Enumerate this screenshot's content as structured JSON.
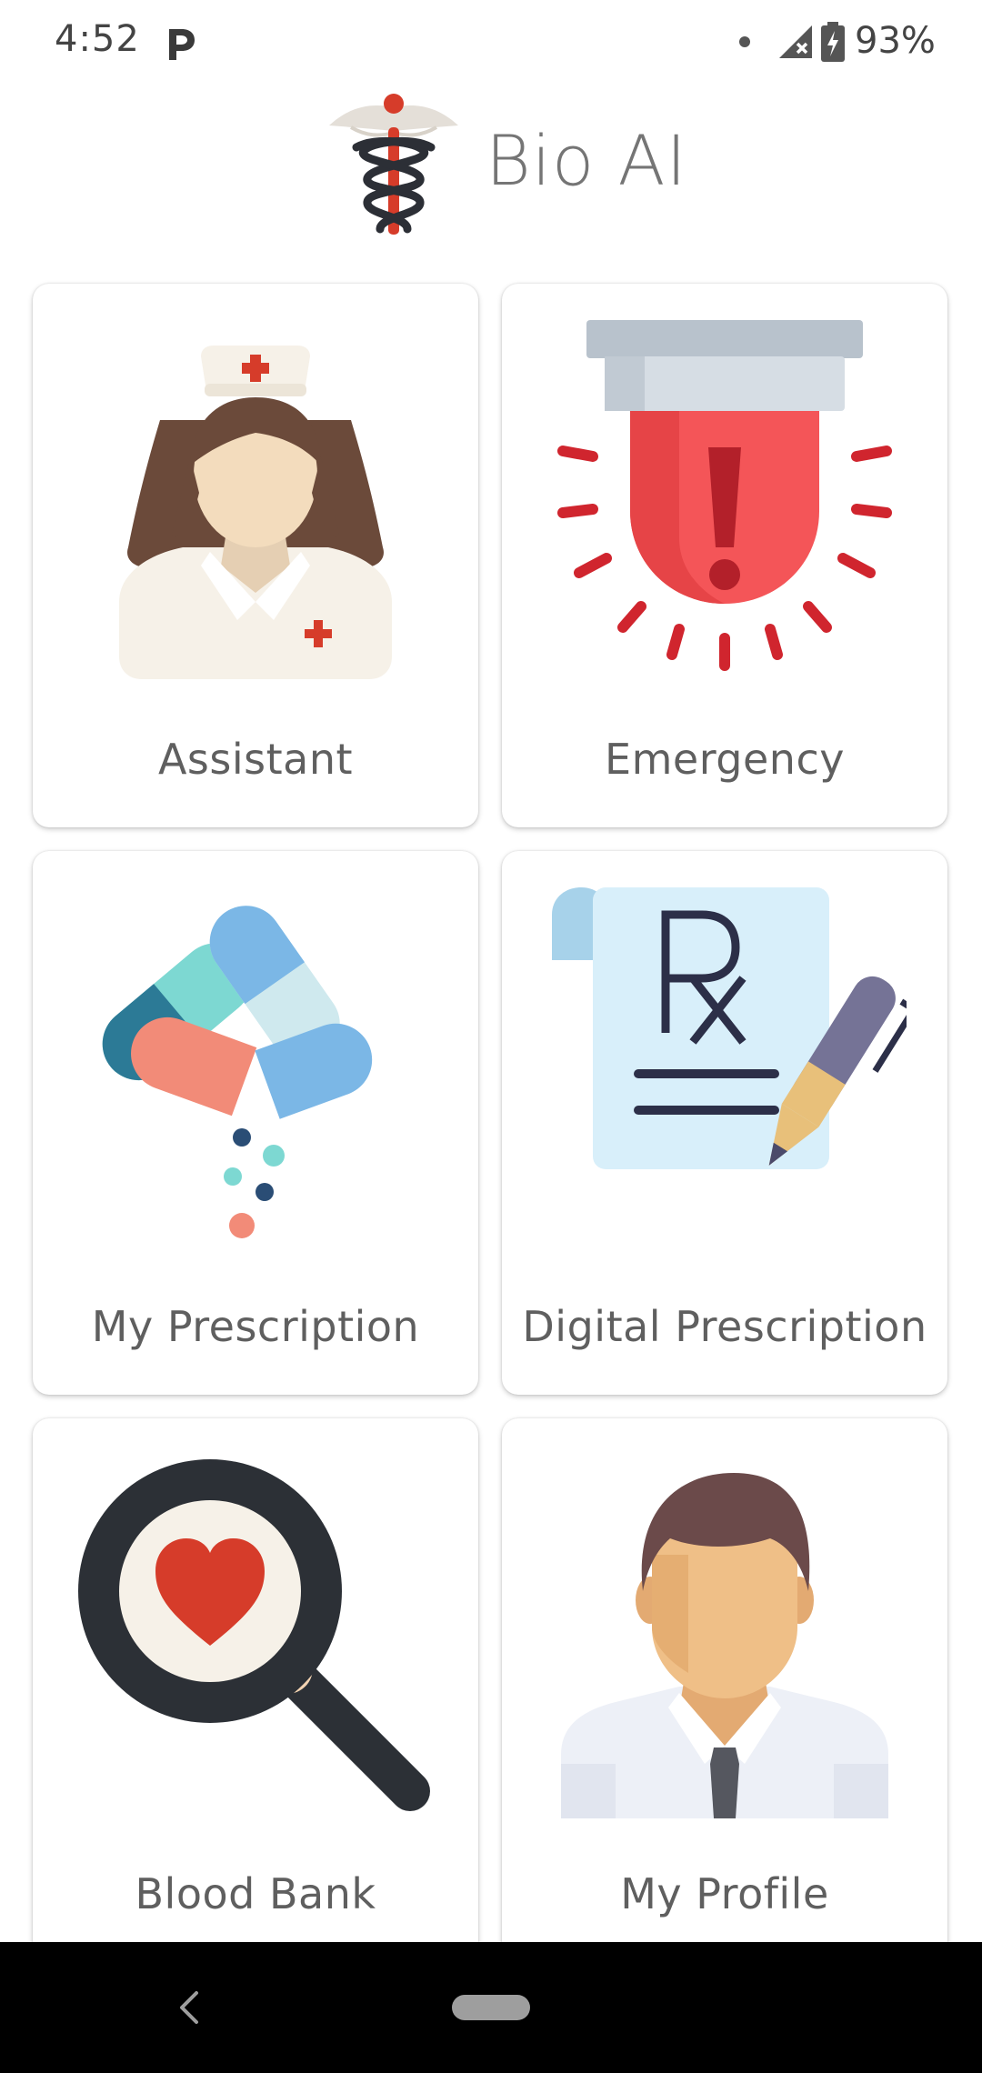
{
  "status_bar": {
    "time": "4:52",
    "battery": "93%",
    "icons": [
      "parking-icon",
      "notification-dot-icon",
      "no-signal-icon",
      "battery-charging-icon"
    ]
  },
  "header": {
    "title": "Bio AI",
    "logo_icon": "caduceus-icon"
  },
  "menu": {
    "items": [
      {
        "label": "Assistant",
        "icon": "nurse-icon"
      },
      {
        "label": "Emergency",
        "icon": "alarm-siren-icon"
      },
      {
        "label": "My Prescription",
        "icon": "pills-icon"
      },
      {
        "label": "Digital Prescription",
        "icon": "rx-prescription-icon"
      },
      {
        "label": "Blood Bank",
        "icon": "heart-search-icon"
      },
      {
        "label": "My Profile",
        "icon": "user-profile-icon"
      }
    ]
  },
  "nav_bar": {
    "icons": [
      "back-icon",
      "home-pill-icon"
    ]
  },
  "colors": {
    "accent_red": "#d63c2a",
    "text_gray": "#5f5f5f",
    "title_gray": "#757575"
  }
}
